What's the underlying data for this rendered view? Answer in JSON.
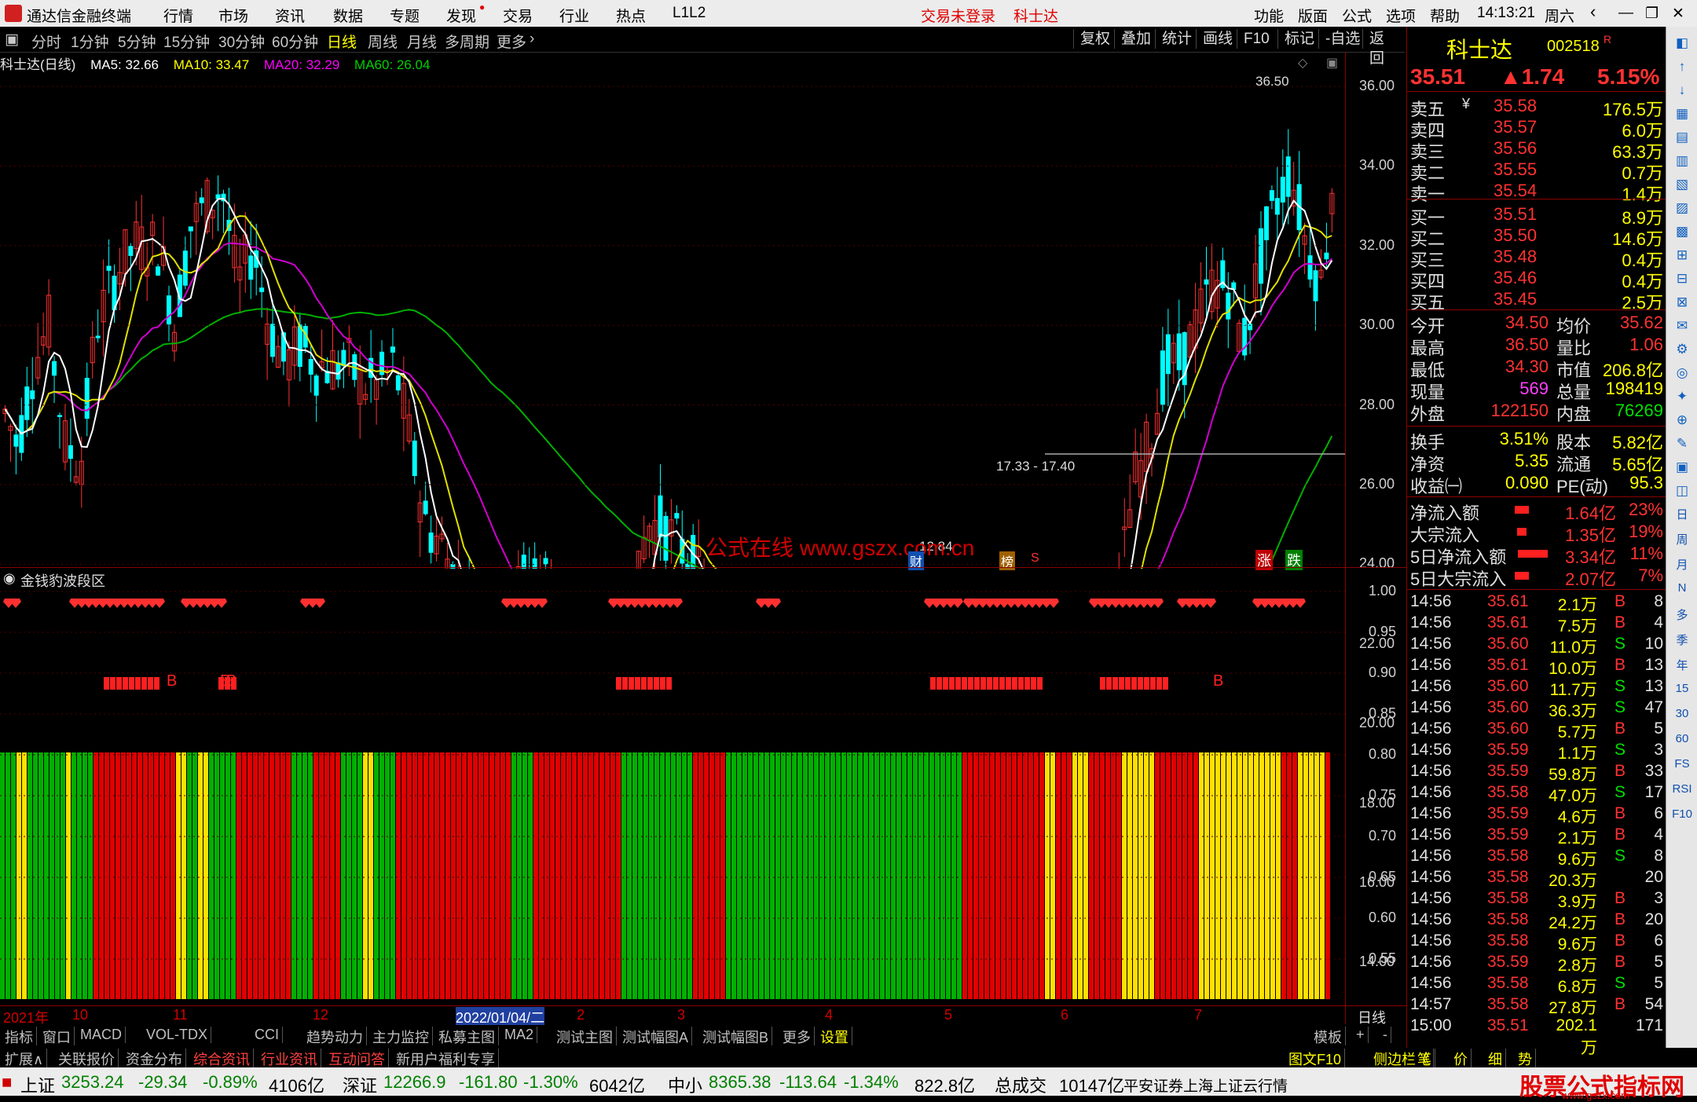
{
  "window": {
    "title": "通达信金融终端",
    "menu": [
      "行情",
      "市场",
      "资讯",
      "数据",
      "专题",
      "发现",
      "交易",
      "行业",
      "热点",
      "L1L2"
    ],
    "login_status": "交易未登录",
    "stock_name_top": "科士达",
    "right_menu": [
      "功能",
      "版面",
      "公式",
      "选项",
      "帮助"
    ],
    "time": "14:13:21",
    "weekday": "周六"
  },
  "period_tabs": [
    "分时",
    "1分钟",
    "5分钟",
    "15分钟",
    "30分钟",
    "60分钟",
    "日线",
    "周线",
    "月线",
    "多周期",
    "更多"
  ],
  "selected_period": "日线",
  "right_tools": [
    "复权",
    "叠加",
    "统计",
    "画线",
    "F10",
    "标记",
    "-自选",
    "返回"
  ],
  "ma_legend": {
    "name": "科士达(日线)",
    "ma5": "MA5: 32.66",
    "ma10": "MA10: 33.47",
    "ma20": "MA20: 32.29",
    "ma60": "MA60: 26.04"
  },
  "price_axis": [
    "36.00",
    "34.00",
    "32.00",
    "30.00",
    "28.00",
    "26.00",
    "24.00",
    "22.00",
    "20.00",
    "18.00",
    "16.00",
    "14.00"
  ],
  "annotations": {
    "high": "36.50",
    "low": "12.84",
    "range": "17.33 - 17.40",
    "watermark": "公式在线 www.gszx.com.cn",
    "markers": [
      "财",
      "榜",
      "S",
      "涨",
      "跌"
    ]
  },
  "indicator": {
    "title": "金钱豹波段区",
    "axis": [
      "1.00",
      "0.95",
      "0.90",
      "0.85",
      "0.80",
      "0.75",
      "0.70",
      "0.65",
      "0.60",
      "0.55"
    ],
    "b_label": "B"
  },
  "date_axis": [
    "2021年",
    "10",
    "11",
    "12",
    "2022/01/04/二",
    "2",
    "3",
    "4",
    "5",
    "6",
    "7"
  ],
  "date_axis_right": "日线",
  "quote": {
    "name": "科士达",
    "code": "002518",
    "r_mark": "R",
    "price": "35.51",
    "change": "▲1.74",
    "pct": "5.15%",
    "asks": [
      {
        "label": "卖五",
        "flag": "¥",
        "price": "35.58",
        "vol": "176.5万"
      },
      {
        "label": "卖四",
        "flag": "",
        "price": "35.57",
        "vol": "6.0万"
      },
      {
        "label": "卖三",
        "flag": "",
        "price": "35.56",
        "vol": "63.3万"
      },
      {
        "label": "卖二",
        "flag": "",
        "price": "35.55",
        "vol": "0.7万"
      },
      {
        "label": "卖一",
        "flag": "",
        "price": "35.54",
        "vol": "1.4万"
      }
    ],
    "bids": [
      {
        "label": "买一",
        "price": "35.51",
        "vol": "8.9万"
      },
      {
        "label": "买二",
        "price": "35.50",
        "vol": "14.6万"
      },
      {
        "label": "买三",
        "price": "35.48",
        "vol": "0.4万"
      },
      {
        "label": "买四",
        "price": "35.46",
        "vol": "0.4万"
      },
      {
        "label": "买五",
        "price": "35.45",
        "vol": "2.5万"
      }
    ],
    "stats": [
      {
        "l1": "今开",
        "v1": "34.50",
        "l2": "均价",
        "v2": "35.62"
      },
      {
        "l1": "最高",
        "v1": "36.50",
        "l2": "量比",
        "v2": "1.06"
      },
      {
        "l1": "最低",
        "v1": "34.30",
        "l2": "市值",
        "v2": "206.8亿"
      },
      {
        "l1": "现量",
        "v1": "569",
        "l2": "总量",
        "v2": "198419"
      },
      {
        "l1": "外盘",
        "v1": "122150",
        "l2": "内盘",
        "v2": "76269"
      }
    ],
    "fund": [
      {
        "l1": "换手",
        "v1": "3.51%",
        "l2": "股本",
        "v2": "5.82亿"
      },
      {
        "l1": "净资",
        "v1": "5.35",
        "l2": "流通",
        "v2": "5.65亿"
      },
      {
        "l1": "收益㈠",
        "v1": "0.090",
        "l2": "PE(动)",
        "v2": "95.3"
      }
    ],
    "flows": [
      {
        "label": "净流入额",
        "val": "1.64亿",
        "pct": "23%"
      },
      {
        "label": "大宗流入",
        "val": "1.35亿",
        "pct": "19%"
      },
      {
        "label": "5日净流入额",
        "val": "3.34亿",
        "pct": "11%"
      },
      {
        "label": "5日大宗流入",
        "val": "2.07亿",
        "pct": "7%"
      }
    ],
    "ticks": [
      {
        "t": "14:56",
        "p": "35.61",
        "v": "2.1万",
        "s": "B",
        "n": "8"
      },
      {
        "t": "14:56",
        "p": "35.61",
        "v": "7.5万",
        "s": "B",
        "n": "4"
      },
      {
        "t": "14:56",
        "p": "35.60",
        "v": "11.0万",
        "s": "S",
        "n": "10"
      },
      {
        "t": "14:56",
        "p": "35.61",
        "v": "10.0万",
        "s": "B",
        "n": "13"
      },
      {
        "t": "14:56",
        "p": "35.60",
        "v": "11.7万",
        "s": "S",
        "n": "13"
      },
      {
        "t": "14:56",
        "p": "35.60",
        "v": "36.3万",
        "s": "S",
        "n": "47"
      },
      {
        "t": "14:56",
        "p": "35.60",
        "v": "5.7万",
        "s": "B",
        "n": "5"
      },
      {
        "t": "14:56",
        "p": "35.59",
        "v": "1.1万",
        "s": "S",
        "n": "3"
      },
      {
        "t": "14:56",
        "p": "35.59",
        "v": "59.8万",
        "s": "B",
        "n": "33"
      },
      {
        "t": "14:56",
        "p": "35.58",
        "v": "47.0万",
        "s": "S",
        "n": "17"
      },
      {
        "t": "14:56",
        "p": "35.59",
        "v": "4.6万",
        "s": "B",
        "n": "6"
      },
      {
        "t": "14:56",
        "p": "35.59",
        "v": "2.1万",
        "s": "B",
        "n": "4"
      },
      {
        "t": "14:56",
        "p": "35.58",
        "v": "9.6万",
        "s": "S",
        "n": "8"
      },
      {
        "t": "14:56",
        "p": "35.58",
        "v": "20.3万",
        "s": "",
        "n": "20"
      },
      {
        "t": "14:56",
        "p": "35.58",
        "v": "3.9万",
        "s": "B",
        "n": "3"
      },
      {
        "t": "14:56",
        "p": "35.58",
        "v": "24.2万",
        "s": "B",
        "n": "20"
      },
      {
        "t": "14:56",
        "p": "35.58",
        "v": "9.6万",
        "s": "B",
        "n": "6"
      },
      {
        "t": "14:56",
        "p": "35.59",
        "v": "2.8万",
        "s": "B",
        "n": "5"
      },
      {
        "t": "14:56",
        "p": "35.58",
        "v": "6.8万",
        "s": "S",
        "n": "5"
      },
      {
        "t": "14:57",
        "p": "35.58",
        "v": "27.8万",
        "s": "B",
        "n": "54"
      },
      {
        "t": "15:00",
        "p": "35.51",
        "v": "202.1万",
        "s": "",
        "n": "171"
      }
    ]
  },
  "sidebar_icons": [
    "日",
    "周",
    "月",
    "N",
    "多",
    "季",
    "年",
    "15",
    "30",
    "60",
    "FS",
    "RSI",
    "F10"
  ],
  "tabs1": [
    "指标",
    "窗口",
    "MACD",
    "VOL-TDX",
    "CCI",
    "趋势动力",
    "主力监控",
    "私募主图",
    "MA2",
    "测试主图",
    "测试幅图A",
    "测试幅图B",
    "更多",
    "设置"
  ],
  "tabs1_right": [
    "模板",
    "+",
    "-"
  ],
  "tabs2": [
    "扩展∧",
    "关联报价",
    "资金分布",
    "综合资讯",
    "行业资讯",
    "互动问答",
    "新用户福利专享"
  ],
  "tabs2_right": [
    "图文F10",
    "侧边栏《",
    "笔",
    "价",
    "细",
    "势"
  ],
  "status": {
    "sh_label": "上证",
    "sh_val": "3253.24",
    "sh_chg": "-29.34",
    "sh_pct": "-0.89%",
    "sh_amt": "4106亿",
    "sz_label": "深证",
    "sz_val": "12266.9",
    "sz_chg": "-161.80",
    "sz_pct": "-1.30%",
    "sz_amt": "6042亿",
    "zx_label": "中小",
    "zx_val": "8365.38",
    "zx_chg": "-113.64",
    "zx_pct": "-1.34%",
    "zx_amt": "822.8亿",
    "total_label": "总成交",
    "total_val": "10147亿",
    "broker": "平安证券上海上证云行情",
    "site_logo": "股票公式指标网",
    "site_url": "www.gszx.com"
  },
  "colors": {
    "up": "#ff3232",
    "down": "#00ffff",
    "ma5": "#ffffff",
    "ma10": "#ffff00",
    "ma20": "#ff00ff",
    "ma60": "#00c000"
  }
}
